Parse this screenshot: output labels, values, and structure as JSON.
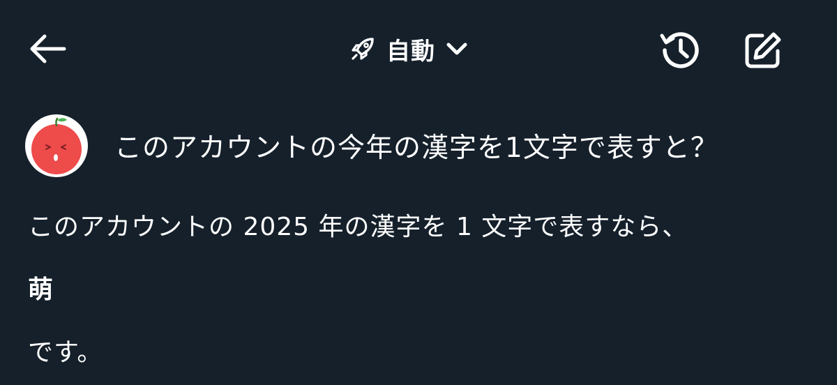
{
  "header": {
    "mode_label": "自動",
    "icons": {
      "back": "arrow-left-icon",
      "mode": "rocket-icon",
      "dropdown": "chevron-down-icon",
      "history": "history-icon",
      "compose": "compose-icon"
    }
  },
  "conversation": {
    "question": "このアカウントの今年の漢字を1文字で表すと？",
    "answer": {
      "line1": "このアカウントの 2025 年の漢字を 1 文字で表すなら、",
      "kanji": "萌",
      "line3": "です。"
    }
  },
  "colors": {
    "background": "#15202b",
    "text": "#ffffff",
    "avatar_apple": "#ee4b4b"
  }
}
